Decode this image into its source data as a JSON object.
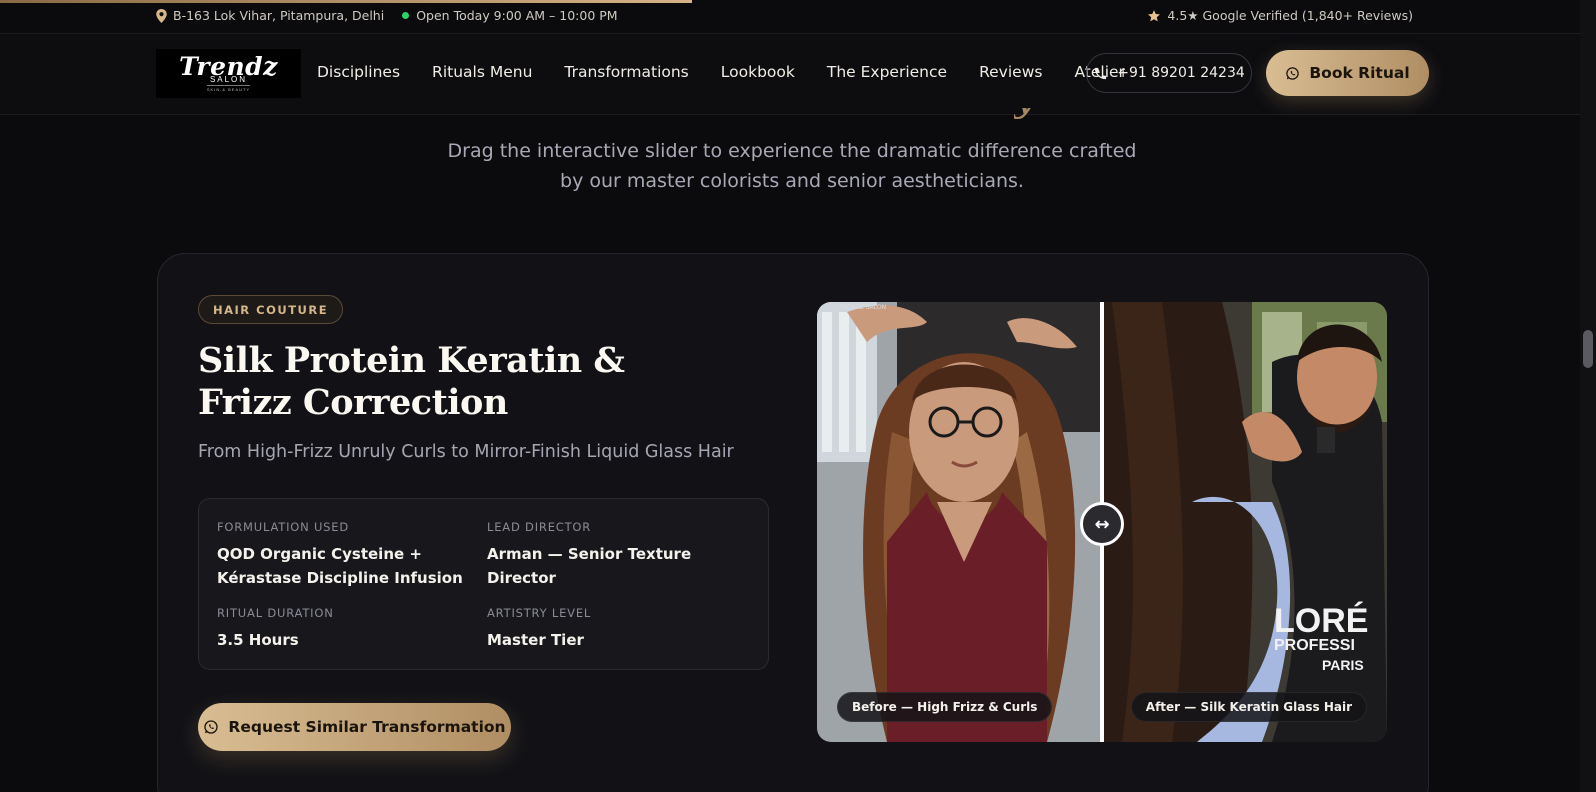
{
  "topbar": {
    "address": "B-163 Lok Vihar, Pitampura, Delhi",
    "hours": "Open Today 9:00 AM – 10:00 PM",
    "rating": "4.5★ Google Verified (1,840+ Reviews)"
  },
  "nav": {
    "logo_brand": "Trendz",
    "logo_sub": "SALON",
    "logo_tiny": "SKIN & BEAUTY",
    "items": [
      "Disciplines",
      "Rituals Menu",
      "Transformations",
      "Lookbook",
      "The Experience",
      "Reviews",
      "Atelier"
    ],
    "phone": "+91 89201 24234",
    "book_label": "Book Ritual"
  },
  "section": {
    "description": "Drag the interactive slider to experience the dramatic difference crafted by our master colorists and senior aestheticians."
  },
  "card": {
    "tag": "HAIR COUTURE",
    "title": "Silk Protein Keratin & Frizz Correction",
    "subtitle": "From High-Frizz Unruly Curls to Mirror-Finish Liquid Glass Hair",
    "specs": [
      {
        "label": "FORMULATION USED",
        "value": "QOD Organic Cysteine + Kérastase Discipline Infusion"
      },
      {
        "label": "LEAD DIRECTOR",
        "value": "Arman — Senior Texture Director"
      },
      {
        "label": "RITUAL DURATION",
        "value": "3.5 Hours"
      },
      {
        "label": "ARTISTRY LEVEL",
        "value": "Master Tier"
      }
    ],
    "cta_label": "Request Similar Transformation",
    "compare": {
      "before_label": "Before — High Frizz & Curls",
      "after_label": "After — Silk Keratin Glass Hair",
      "slider_position": 0.5,
      "handle_icon": "↔",
      "after_photo_text_1": "LORÉ",
      "after_photo_text_2": "PROFESSI",
      "after_photo_text_3": "PARIS"
    }
  },
  "colors": {
    "accent_gold": "#c9a46e",
    "background": "#0b0b0e",
    "open_status": "#2bd46b"
  }
}
